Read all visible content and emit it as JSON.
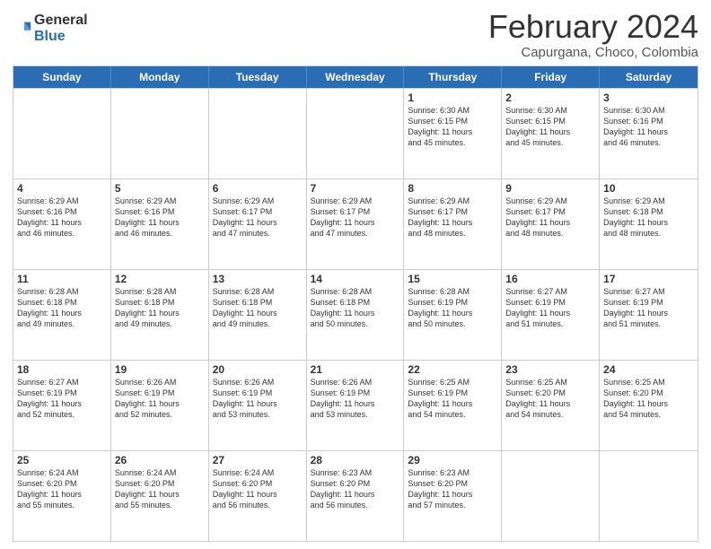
{
  "header": {
    "logo_general": "General",
    "logo_blue": "Blue",
    "title": "February 2024",
    "subtitle": "Capurgana, Choco, Colombia"
  },
  "weekdays": [
    "Sunday",
    "Monday",
    "Tuesday",
    "Wednesday",
    "Thursday",
    "Friday",
    "Saturday"
  ],
  "rows": [
    [
      {
        "date": "",
        "info": ""
      },
      {
        "date": "",
        "info": ""
      },
      {
        "date": "",
        "info": ""
      },
      {
        "date": "",
        "info": ""
      },
      {
        "date": "1",
        "info": "Sunrise: 6:30 AM\nSunset: 6:15 PM\nDaylight: 11 hours\nand 45 minutes."
      },
      {
        "date": "2",
        "info": "Sunrise: 6:30 AM\nSunset: 6:15 PM\nDaylight: 11 hours\nand 45 minutes."
      },
      {
        "date": "3",
        "info": "Sunrise: 6:30 AM\nSunset: 6:16 PM\nDaylight: 11 hours\nand 46 minutes."
      }
    ],
    [
      {
        "date": "4",
        "info": "Sunrise: 6:29 AM\nSunset: 6:16 PM\nDaylight: 11 hours\nand 46 minutes."
      },
      {
        "date": "5",
        "info": "Sunrise: 6:29 AM\nSunset: 6:16 PM\nDaylight: 11 hours\nand 46 minutes."
      },
      {
        "date": "6",
        "info": "Sunrise: 6:29 AM\nSunset: 6:17 PM\nDaylight: 11 hours\nand 47 minutes."
      },
      {
        "date": "7",
        "info": "Sunrise: 6:29 AM\nSunset: 6:17 PM\nDaylight: 11 hours\nand 47 minutes."
      },
      {
        "date": "8",
        "info": "Sunrise: 6:29 AM\nSunset: 6:17 PM\nDaylight: 11 hours\nand 48 minutes."
      },
      {
        "date": "9",
        "info": "Sunrise: 6:29 AM\nSunset: 6:17 PM\nDaylight: 11 hours\nand 48 minutes."
      },
      {
        "date": "10",
        "info": "Sunrise: 6:29 AM\nSunset: 6:18 PM\nDaylight: 11 hours\nand 48 minutes."
      }
    ],
    [
      {
        "date": "11",
        "info": "Sunrise: 6:28 AM\nSunset: 6:18 PM\nDaylight: 11 hours\nand 49 minutes."
      },
      {
        "date": "12",
        "info": "Sunrise: 6:28 AM\nSunset: 6:18 PM\nDaylight: 11 hours\nand 49 minutes."
      },
      {
        "date": "13",
        "info": "Sunrise: 6:28 AM\nSunset: 6:18 PM\nDaylight: 11 hours\nand 49 minutes."
      },
      {
        "date": "14",
        "info": "Sunrise: 6:28 AM\nSunset: 6:18 PM\nDaylight: 11 hours\nand 50 minutes."
      },
      {
        "date": "15",
        "info": "Sunrise: 6:28 AM\nSunset: 6:19 PM\nDaylight: 11 hours\nand 50 minutes."
      },
      {
        "date": "16",
        "info": "Sunrise: 6:27 AM\nSunset: 6:19 PM\nDaylight: 11 hours\nand 51 minutes."
      },
      {
        "date": "17",
        "info": "Sunrise: 6:27 AM\nSunset: 6:19 PM\nDaylight: 11 hours\nand 51 minutes."
      }
    ],
    [
      {
        "date": "18",
        "info": "Sunrise: 6:27 AM\nSunset: 6:19 PM\nDaylight: 11 hours\nand 52 minutes."
      },
      {
        "date": "19",
        "info": "Sunrise: 6:26 AM\nSunset: 6:19 PM\nDaylight: 11 hours\nand 52 minutes."
      },
      {
        "date": "20",
        "info": "Sunrise: 6:26 AM\nSunset: 6:19 PM\nDaylight: 11 hours\nand 53 minutes."
      },
      {
        "date": "21",
        "info": "Sunrise: 6:26 AM\nSunset: 6:19 PM\nDaylight: 11 hours\nand 53 minutes."
      },
      {
        "date": "22",
        "info": "Sunrise: 6:25 AM\nSunset: 6:19 PM\nDaylight: 11 hours\nand 54 minutes."
      },
      {
        "date": "23",
        "info": "Sunrise: 6:25 AM\nSunset: 6:20 PM\nDaylight: 11 hours\nand 54 minutes."
      },
      {
        "date": "24",
        "info": "Sunrise: 6:25 AM\nSunset: 6:20 PM\nDaylight: 11 hours\nand 54 minutes."
      }
    ],
    [
      {
        "date": "25",
        "info": "Sunrise: 6:24 AM\nSunset: 6:20 PM\nDaylight: 11 hours\nand 55 minutes."
      },
      {
        "date": "26",
        "info": "Sunrise: 6:24 AM\nSunset: 6:20 PM\nDaylight: 11 hours\nand 55 minutes."
      },
      {
        "date": "27",
        "info": "Sunrise: 6:24 AM\nSunset: 6:20 PM\nDaylight: 11 hours\nand 56 minutes."
      },
      {
        "date": "28",
        "info": "Sunrise: 6:23 AM\nSunset: 6:20 PM\nDaylight: 11 hours\nand 56 minutes."
      },
      {
        "date": "29",
        "info": "Sunrise: 6:23 AM\nSunset: 6:20 PM\nDaylight: 11 hours\nand 57 minutes."
      },
      {
        "date": "",
        "info": ""
      },
      {
        "date": "",
        "info": ""
      }
    ]
  ]
}
